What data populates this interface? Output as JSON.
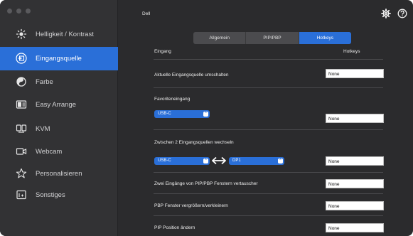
{
  "window": {
    "title": "Dell"
  },
  "sidebar": {
    "items": [
      {
        "label": "Helligkeit / Kontrast",
        "icon": "brightness-icon",
        "active": false
      },
      {
        "label": "Eingangsquelle",
        "icon": "input-source-icon",
        "active": true
      },
      {
        "label": "Farbe",
        "icon": "color-icon",
        "active": false
      },
      {
        "label": "Easy Arrange",
        "icon": "easy-arrange-icon",
        "active": false
      },
      {
        "label": "KVM",
        "icon": "kvm-icon",
        "active": false
      },
      {
        "label": "Webcam",
        "icon": "webcam-icon",
        "active": false
      },
      {
        "label": "Personalisieren",
        "icon": "star-icon",
        "active": false
      },
      {
        "label": "Sonstiges",
        "icon": "others-icon",
        "active": false
      }
    ]
  },
  "tabs": [
    {
      "label": "Allgemein",
      "active": false
    },
    {
      "label": "PIP/PBP",
      "active": false
    },
    {
      "label": "Hotkeys",
      "active": true
    }
  ],
  "table": {
    "col_input": "Eingang",
    "col_hotkeys": "Hotkeys"
  },
  "rows": {
    "switch_current": {
      "label": "Aktuelle Eingangsquelle umschalten",
      "hotkey": "None"
    },
    "favorite": {
      "label": "Favoriteneingang",
      "select": "USB-C",
      "hotkey": "None"
    },
    "switch_two": {
      "label": "Zwischen 2 Eingangsquellen wechseln",
      "select_a": "USB-C",
      "select_b": "DP1",
      "hotkey": "None"
    },
    "swap_pip": {
      "label": "Zwei Eingänge von PIP/PBP Fenstern vertauscher",
      "hotkey": "None"
    },
    "pbp_resize": {
      "label": "PBP Fenster vergrößern/verkleinern",
      "hotkey": "None"
    },
    "pip_position": {
      "label": "PIP Position ändern",
      "hotkey": "None"
    }
  },
  "colors": {
    "accent": "#2a6fd8",
    "sidebar_bg": "#323234",
    "main_bg": "#2b2b2d"
  }
}
